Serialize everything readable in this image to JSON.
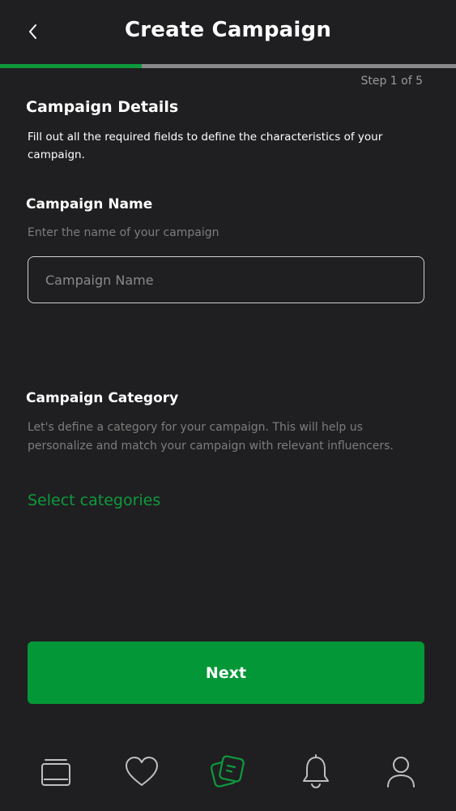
{
  "header": {
    "back_icon": "chevron-left-icon",
    "title": "Create Campaign"
  },
  "progress": {
    "current_step": 1,
    "total_steps": 5,
    "fraction": 0.31,
    "label": "Step 1 of 5",
    "accent_color": "#0e9a3c"
  },
  "details": {
    "title": "Campaign Details",
    "description": "Fill out all the required fields to define the characteristics of your campaign."
  },
  "campaign_name": {
    "title": "Campaign Name",
    "hint": "Enter the name of your campaign",
    "placeholder": "Campaign Name",
    "value": ""
  },
  "campaign_category": {
    "title": "Campaign Category",
    "hint": "Let's define a category for your campaign. This will help us personalize and match your campaign with relevant influencers.",
    "select_label": "Select categories"
  },
  "next_button": {
    "label": "Next",
    "color": "#049737"
  },
  "tabbar": {
    "items": [
      {
        "icon": "gallery-icon",
        "active": false
      },
      {
        "icon": "heart-icon",
        "active": false
      },
      {
        "icon": "campaigns-icon",
        "active": true
      },
      {
        "icon": "bell-icon",
        "active": false
      },
      {
        "icon": "profile-icon",
        "active": false
      }
    ],
    "active_color": "#0e9a3c",
    "inactive_color": "#bfbfbf"
  }
}
